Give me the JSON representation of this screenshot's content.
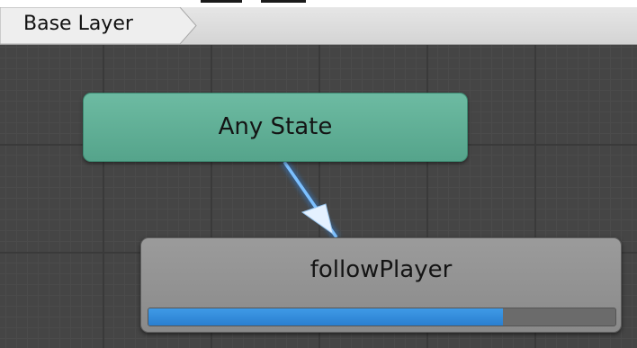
{
  "breadcrumb": {
    "items": [
      {
        "label": "Base Layer"
      }
    ]
  },
  "states": {
    "any_state": {
      "label": "Any State"
    },
    "follow_player": {
      "label": "followPlayer",
      "progress": 0.76
    }
  },
  "transition": {
    "from": "Any State",
    "to": "followPlayer"
  },
  "colors": {
    "any_state": "#5fae95",
    "state": "#929292",
    "progress": "#3a8fde",
    "transition": "#5aa9f5",
    "graph_background": "#454545"
  }
}
